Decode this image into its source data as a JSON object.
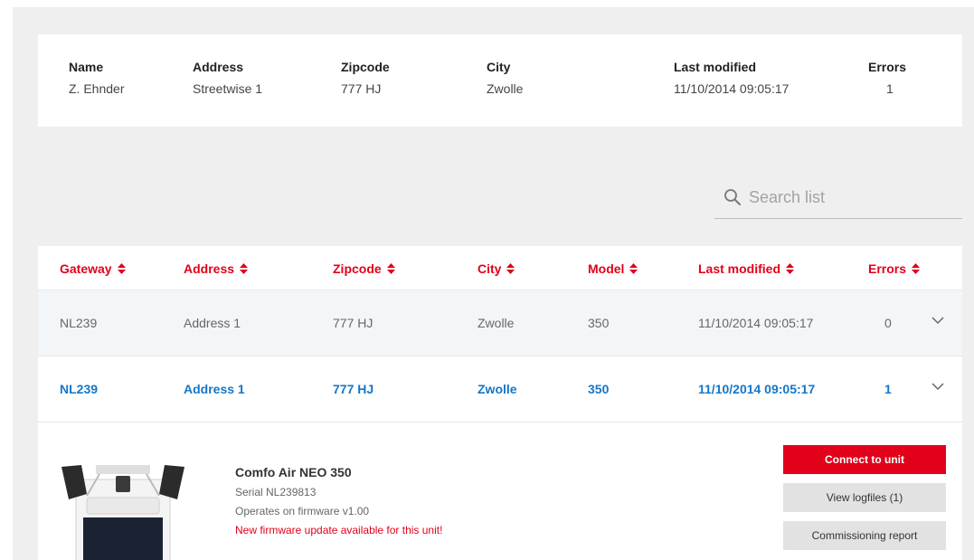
{
  "customer": {
    "headers": [
      "Name",
      "Address",
      "Zipcode",
      "City",
      "Last modified",
      "Errors"
    ],
    "values": [
      "Z. Ehnder",
      "Streetwise 1",
      "777 HJ",
      "Zwolle",
      "11/10/2014 09:05:17",
      "1"
    ]
  },
  "search": {
    "placeholder": "Search list",
    "icon": "search-icon"
  },
  "table": {
    "columns": [
      "Gateway",
      "Address",
      "Zipcode",
      "City",
      "Model",
      "Last modified",
      "Errors"
    ],
    "rows": [
      [
        "NL239",
        "Address 1",
        "777 HJ",
        "Zwolle",
        "350",
        "11/10/2014 09:05:17",
        "0"
      ],
      [
        "NL239",
        "Address 1",
        "777 HJ",
        "Zwolle",
        "350",
        "11/10/2014 09:05:17",
        "1"
      ]
    ]
  },
  "unit": {
    "name": "Comfo Air NEO 350",
    "serial": "Serial NL239813",
    "firmware": "Operates on firmware v1.00",
    "update_notice": "New firmware update available for this unit!"
  },
  "actions": {
    "connect": "Connect to unit",
    "logfiles": "View logfiles (1)",
    "report": "Commissioning report"
  },
  "colors": {
    "accent": "#e2001a",
    "link": "#1476c8",
    "background": "#efefef"
  }
}
